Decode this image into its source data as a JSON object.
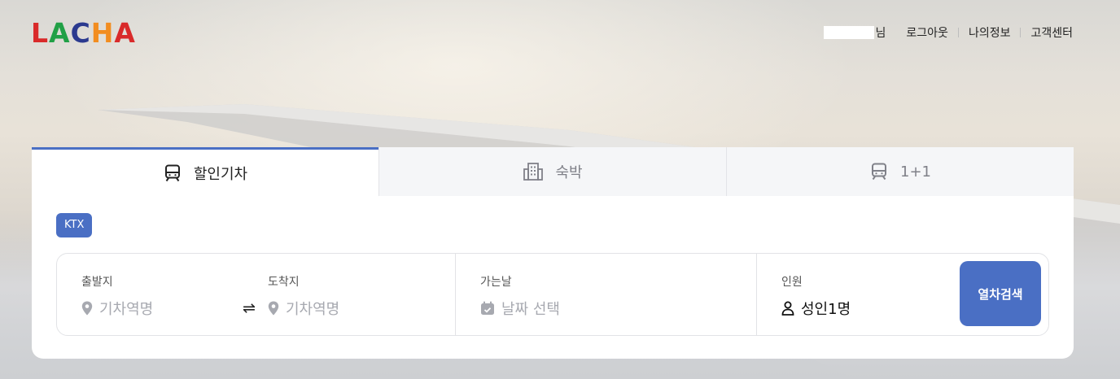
{
  "brand": {
    "logo_letters": [
      {
        "char": "L",
        "color": "#d92a2a"
      },
      {
        "char": "A",
        "color": "#21a046"
      },
      {
        "char": "C",
        "color": "#2b3a8f"
      },
      {
        "char": "H",
        "color": "#f28d20"
      },
      {
        "char": "A",
        "color": "#d92a2a"
      }
    ]
  },
  "header": {
    "user_suffix": "님",
    "logout": "로그아웃",
    "my_info": "나의정보",
    "support": "고객센터"
  },
  "tabs": [
    {
      "label": "할인기차",
      "icon": "train-icon",
      "active": true
    },
    {
      "label": "숙박",
      "icon": "building-icon",
      "active": false
    },
    {
      "label": "1+1",
      "icon": "train-icon",
      "active": false
    }
  ],
  "badge": "KTX",
  "form": {
    "departure": {
      "label": "출발지",
      "placeholder": "기차역명"
    },
    "arrival": {
      "label": "도착지",
      "placeholder": "기차역명"
    },
    "date": {
      "label": "가는날",
      "placeholder": "날짜 선택"
    },
    "passengers": {
      "label": "인원",
      "value": "성인1명"
    },
    "swap_icon": "swap-arrows-icon",
    "search_button": "열차검색"
  },
  "colors": {
    "accent": "#4a6fc4",
    "muted_text": "#a7a9b0"
  }
}
